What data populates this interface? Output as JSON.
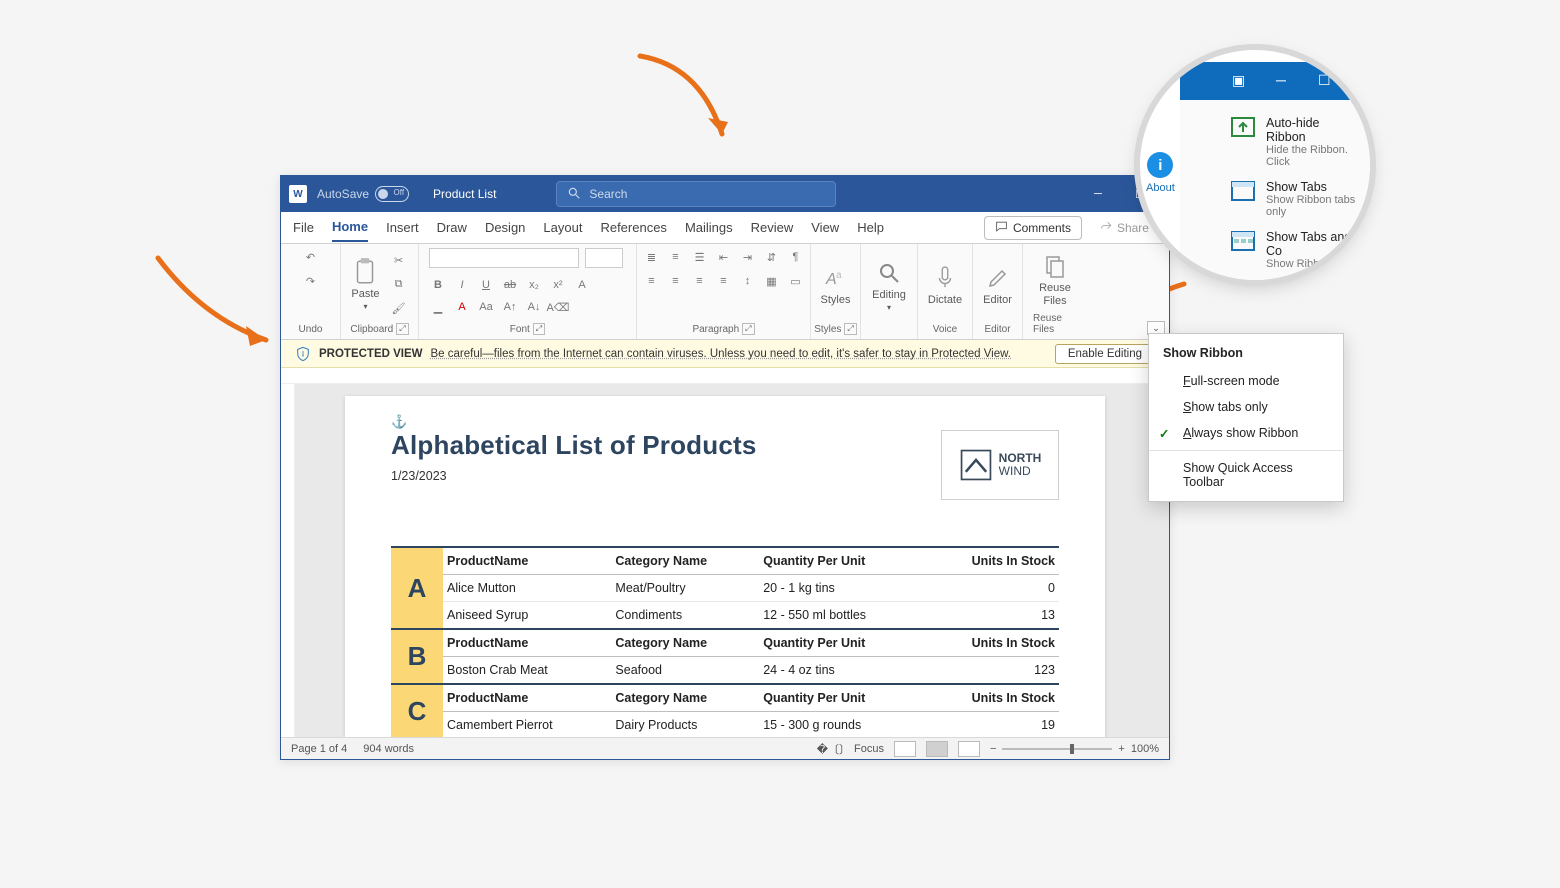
{
  "titlebar": {
    "autosave_label": "AutoSave",
    "autosave_state": "Off",
    "doc_title": "Product List",
    "search_placeholder": "Search"
  },
  "tabs": [
    "File",
    "Home",
    "Insert",
    "Draw",
    "Design",
    "Layout",
    "References",
    "Mailings",
    "Review",
    "View",
    "Help"
  ],
  "active_tab": "Home",
  "comments_label": "Comments",
  "share_label": "Share",
  "ribbon_groups": {
    "undo": "Undo",
    "clipboard": "Clipboard",
    "paste": "Paste",
    "font": "Font",
    "paragraph": "Paragraph",
    "styles": "Styles",
    "editing": "Editing",
    "dictate": "Dictate",
    "editor": "Editor",
    "reuse": "Reuse Files",
    "voice": "Voice",
    "editor_grp": "Editor",
    "reuse_grp": "Reuse Files"
  },
  "font_buttons": [
    "B",
    "I",
    "U",
    "ab",
    "x₂",
    "x²",
    "A"
  ],
  "protected": {
    "title": "PROTECTED VIEW",
    "msg": "Be careful—files from the Internet can contain viruses. Unless you need to edit, it's safer to stay in Protected View.",
    "button": "Enable Editing"
  },
  "document": {
    "title": "Alphabetical List of Products",
    "date": "1/23/2023",
    "logo_text_1": "NORTH",
    "logo_text_2": "WIND",
    "columns": [
      "ProductName",
      "Category Name",
      "Quantity Per Unit",
      "Units In Stock"
    ],
    "sections": [
      {
        "letter": "A",
        "rows": [
          {
            "name": "Alice Mutton",
            "cat": "Meat/Poultry",
            "qty": "20 - 1 kg tins",
            "stock": "0"
          },
          {
            "name": "Aniseed Syrup",
            "cat": "Condiments",
            "qty": "12 - 550 ml bottles",
            "stock": "13"
          }
        ]
      },
      {
        "letter": "B",
        "rows": [
          {
            "name": "Boston Crab Meat",
            "cat": "Seafood",
            "qty": "24 - 4 oz tins",
            "stock": "123"
          }
        ]
      },
      {
        "letter": "C",
        "rows": [
          {
            "name": "Camembert Pierrot",
            "cat": "Dairy Products",
            "qty": "15 - 300 g rounds",
            "stock": "19"
          }
        ]
      }
    ]
  },
  "status": {
    "page": "Page 1 of 4",
    "words": "904 words",
    "focus": "Focus",
    "zoom": "100%"
  },
  "dropdown": {
    "title": "Show Ribbon",
    "items": [
      {
        "label": "Full-screen mode",
        "checked": false,
        "underline": "F"
      },
      {
        "label": "Show tabs only",
        "checked": false,
        "underline": "S"
      },
      {
        "label": "Always show Ribbon",
        "checked": true,
        "underline": "A"
      }
    ],
    "extra": "Show Quick Access Toolbar"
  },
  "magnifier": {
    "about": "About",
    "options": [
      {
        "title": "Auto-hide Ribbon",
        "sub": "Hide the Ribbon. Click"
      },
      {
        "title": "Show Tabs",
        "sub": "Show Ribbon tabs only"
      },
      {
        "title": "Show Tabs and Co",
        "sub": "Show Ribbon tab"
      }
    ]
  }
}
